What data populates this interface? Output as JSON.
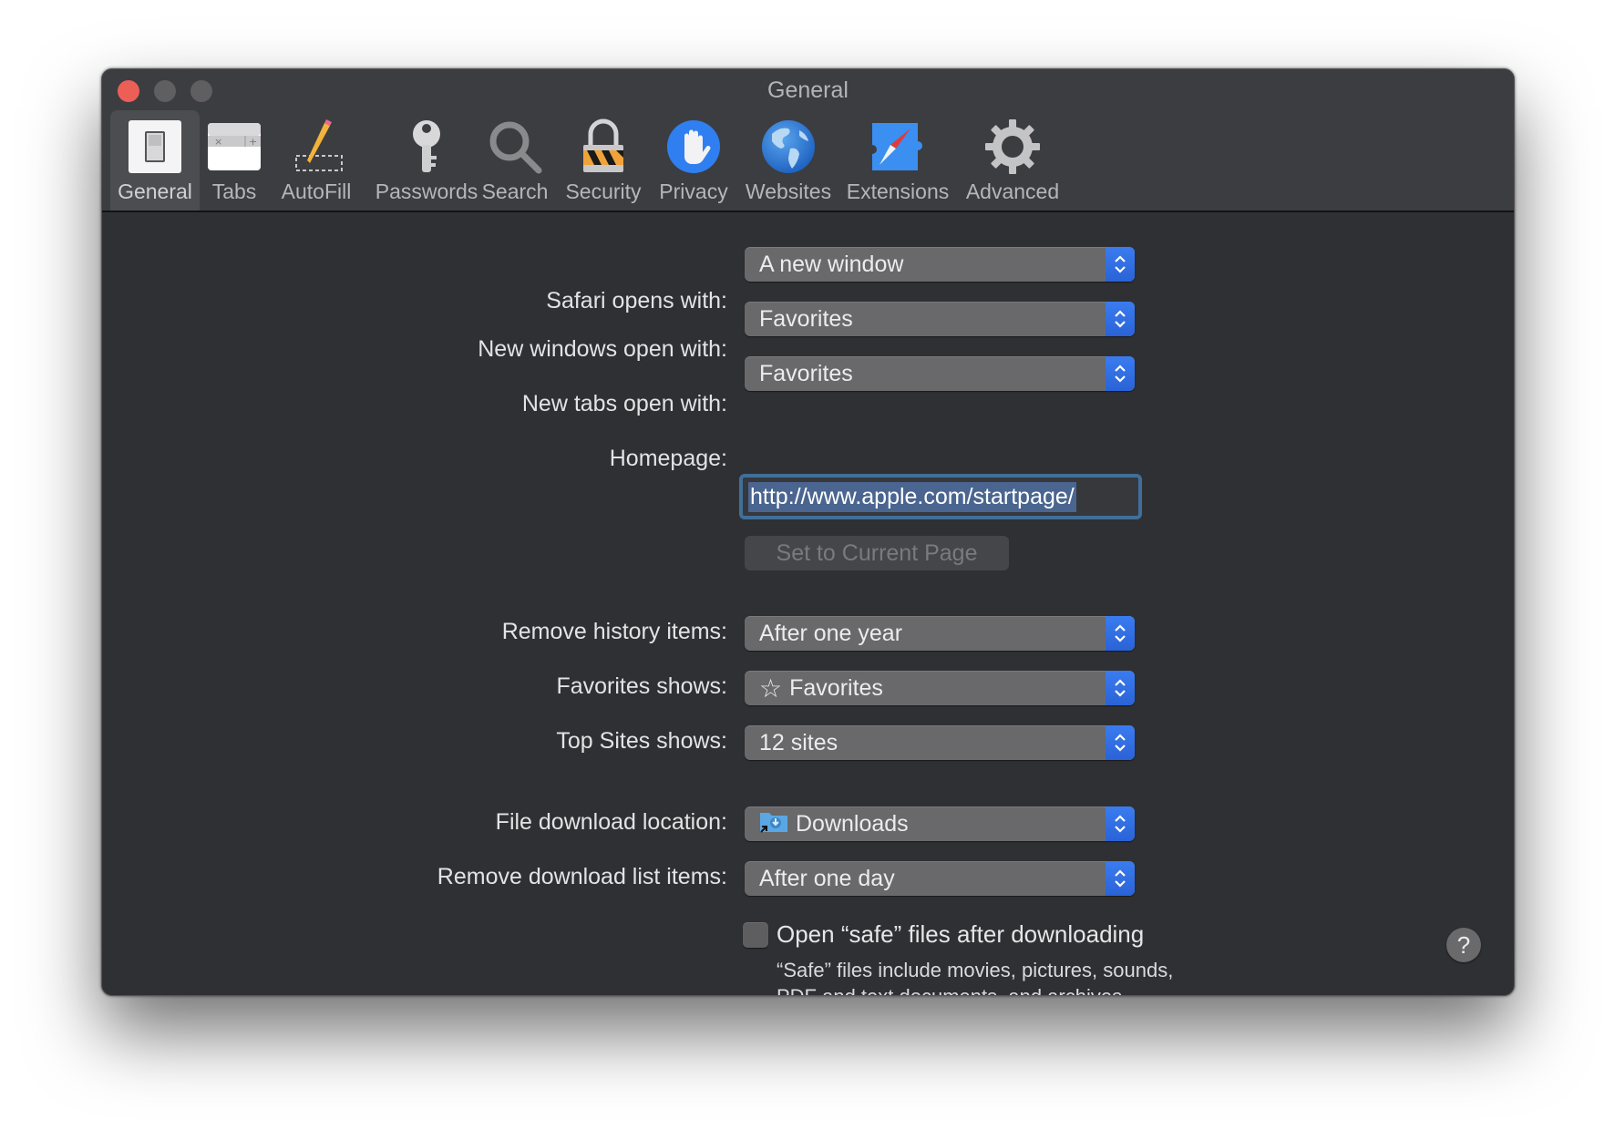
{
  "window": {
    "title": "General",
    "traffic_lights": [
      "close",
      "minimize",
      "zoom"
    ]
  },
  "toolbar": {
    "selected": "General",
    "items": [
      {
        "label": "General",
        "icon": "general-switch-icon"
      },
      {
        "label": "Tabs",
        "icon": "tabs-icon"
      },
      {
        "label": "AutoFill",
        "icon": "autofill-pencil-icon"
      },
      {
        "label": "Passwords",
        "icon": "key-icon"
      },
      {
        "label": "Search",
        "icon": "magnifier-icon"
      },
      {
        "label": "Security",
        "icon": "padlock-icon"
      },
      {
        "label": "Privacy",
        "icon": "hand-icon"
      },
      {
        "label": "Websites",
        "icon": "globe-icon"
      },
      {
        "label": "Extensions",
        "icon": "puzzle-compass-icon"
      },
      {
        "label": "Advanced",
        "icon": "gear-icon"
      }
    ]
  },
  "settings": {
    "safari_opens_with": {
      "label": "Safari opens with:",
      "value": "A new window"
    },
    "new_windows_open_with": {
      "label": "New windows open with:",
      "value": "Favorites"
    },
    "new_tabs_open_with": {
      "label": "New tabs open with:",
      "value": "Favorites"
    },
    "homepage": {
      "label": "Homepage:",
      "value": "http://www.apple.com/startpage/"
    },
    "set_current_page": {
      "label": "Set to Current Page",
      "enabled": false
    },
    "remove_history_items": {
      "label": "Remove history items:",
      "value": "After one year"
    },
    "favorites_shows": {
      "label": "Favorites shows:",
      "value": "Favorites",
      "icon": "star-icon"
    },
    "top_sites_shows": {
      "label": "Top Sites shows:",
      "value": "12 sites"
    },
    "file_download_location": {
      "label": "File download location:",
      "value": "Downloads",
      "icon": "downloads-folder-icon"
    },
    "remove_download_list_items": {
      "label": "Remove download list items:",
      "value": "After one day"
    },
    "open_safe_files": {
      "label": "Open “safe” files after downloading",
      "checked": false,
      "help": "“Safe” files include movies, pictures, sounds, PDF and text documents, and archives."
    }
  },
  "help_button": {
    "label": "?"
  },
  "colors": {
    "accent": "#2f6fe4",
    "window_bg": "#2f3033",
    "toolbar_bg": "#3c3d41",
    "close": "#ec5f57",
    "focus_ring": "#3f6f9a",
    "selection": "#4a6590"
  }
}
